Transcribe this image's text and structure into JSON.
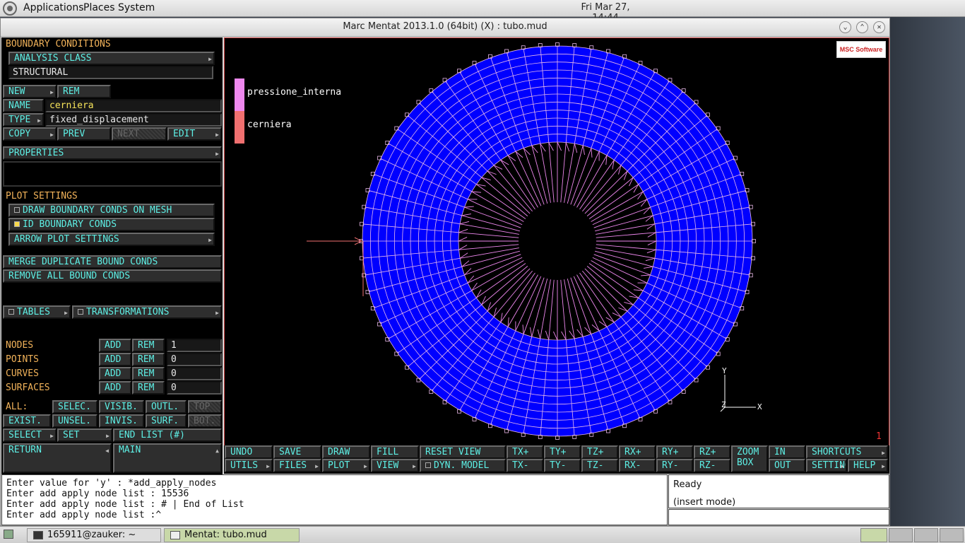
{
  "topbar": {
    "menus": [
      "Applications",
      "Places",
      "System"
    ],
    "clock": "Fri Mar 27, 14:44"
  },
  "window": {
    "title": "Marc Mentat 2013.1.0 (64bit) (X) : tubo.mud"
  },
  "panel": {
    "header": "BOUNDARY CONDITIONS",
    "analysis_class_btn": "ANALYSIS CLASS",
    "analysis_class_val": "STRUCTURAL",
    "new": "NEW",
    "rem": "REM",
    "name_label": "NAME",
    "name_value": "cerniera",
    "type_label": "TYPE",
    "type_value": "fixed_displacement",
    "copy": "COPY",
    "prev": "PREV",
    "next": "NEXT",
    "edit": "EDIT",
    "properties": "PROPERTIES",
    "plot_settings": "PLOT SETTINGS",
    "draw_bc": "DRAW BOUNDARY CONDS ON MESH",
    "id_bc": "ID BOUNDARY CONDS",
    "arrow_plot": "ARROW PLOT SETTINGS",
    "merge": "MERGE DUPLICATE BOUND CONDS",
    "remove_all": "REMOVE ALL BOUND CONDS",
    "tables": "TABLES",
    "transformations": "TRANSFORMATIONS",
    "entities": [
      {
        "label": "NODES",
        "count": "1"
      },
      {
        "label": "POINTS",
        "count": "0"
      },
      {
        "label": "CURVES",
        "count": "0"
      },
      {
        "label": "SURFACES",
        "count": "0"
      }
    ],
    "add": "ADD",
    "all_label": "ALL:",
    "selec": "SELEC.",
    "visib": "VISIB.",
    "outl": "OUTL.",
    "top": "TOP",
    "exist": "EXIST.",
    "unsel": "UNSEL.",
    "invis": "INVIS.",
    "surf": "SURF.",
    "bot": "BOT.",
    "select": "SELECT",
    "set": "SET",
    "end_list": "END LIST (#)",
    "return": "RETURN",
    "main": "MAIN"
  },
  "viewport": {
    "legend": [
      {
        "name": "pressione_interna",
        "color": "#ee88ee"
      },
      {
        "name": "cerniera",
        "color": "#f07070"
      }
    ],
    "logo_text": "MSC Software",
    "axis_x": "X",
    "axis_y": "Y",
    "axis_z": "Z",
    "view_number": "1",
    "mesh_color": "#0000ff"
  },
  "toolbar": {
    "row1": [
      "UNDO",
      "SAVE",
      "DRAW",
      "FILL",
      "RESET VIEW",
      "TX+",
      "TY+",
      "TZ+",
      "RX+",
      "RY+",
      "RZ+"
    ],
    "row2": [
      "UTILS",
      "FILES",
      "PLOT",
      "VIEW",
      "DYN. MODEL",
      "TX-",
      "TY-",
      "TZ-",
      "RX-",
      "RY-",
      "RZ-"
    ],
    "zoom_box": "ZOOM BOX",
    "in": "IN",
    "out": "OUT",
    "shortcuts": "SHORTCUTS",
    "settings": "SETTINGS",
    "help": "HELP"
  },
  "console": {
    "lines": [
      "Enter value for 'y' : *add_apply_nodes",
      "Enter add apply node list :  15536",
      "Enter add apply node list :  # | End of List",
      "Enter add apply node list :"
    ]
  },
  "status": {
    "text": "Ready",
    "mode": "(insert mode)"
  },
  "taskbar": {
    "tasks": [
      "165911@zauker: ~",
      "Mentat: tubo.mud"
    ]
  }
}
